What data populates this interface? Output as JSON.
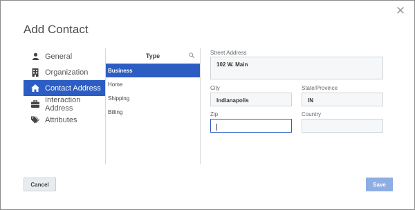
{
  "dialog": {
    "title": "Add Contact"
  },
  "nav": {
    "items": [
      {
        "label": "General",
        "icon": "user-icon"
      },
      {
        "label": "Organization",
        "icon": "building-icon"
      },
      {
        "label": "Contact Address",
        "icon": "home-icon",
        "active": true
      },
      {
        "label": "Interaction Address",
        "icon": "briefcase-icon"
      },
      {
        "label": "Attributes",
        "icon": "tags-icon"
      }
    ]
  },
  "type_panel": {
    "header": "Type",
    "items": [
      "Business",
      "Home",
      "Shipping",
      "Billing"
    ],
    "selected": "Business"
  },
  "form": {
    "street": {
      "label": "Street Address",
      "value": "102 W. Main"
    },
    "city": {
      "label": "City",
      "value": "Indianapolis"
    },
    "state": {
      "label": "State/Province",
      "value": "IN"
    },
    "zip": {
      "label": "Zip",
      "value": ""
    },
    "country": {
      "label": "Country",
      "value": ""
    }
  },
  "buttons": {
    "cancel": "Cancel",
    "save": "Save"
  },
  "colors": {
    "accent": "#2c5dc3",
    "save_disabled": "#8eaee3"
  }
}
